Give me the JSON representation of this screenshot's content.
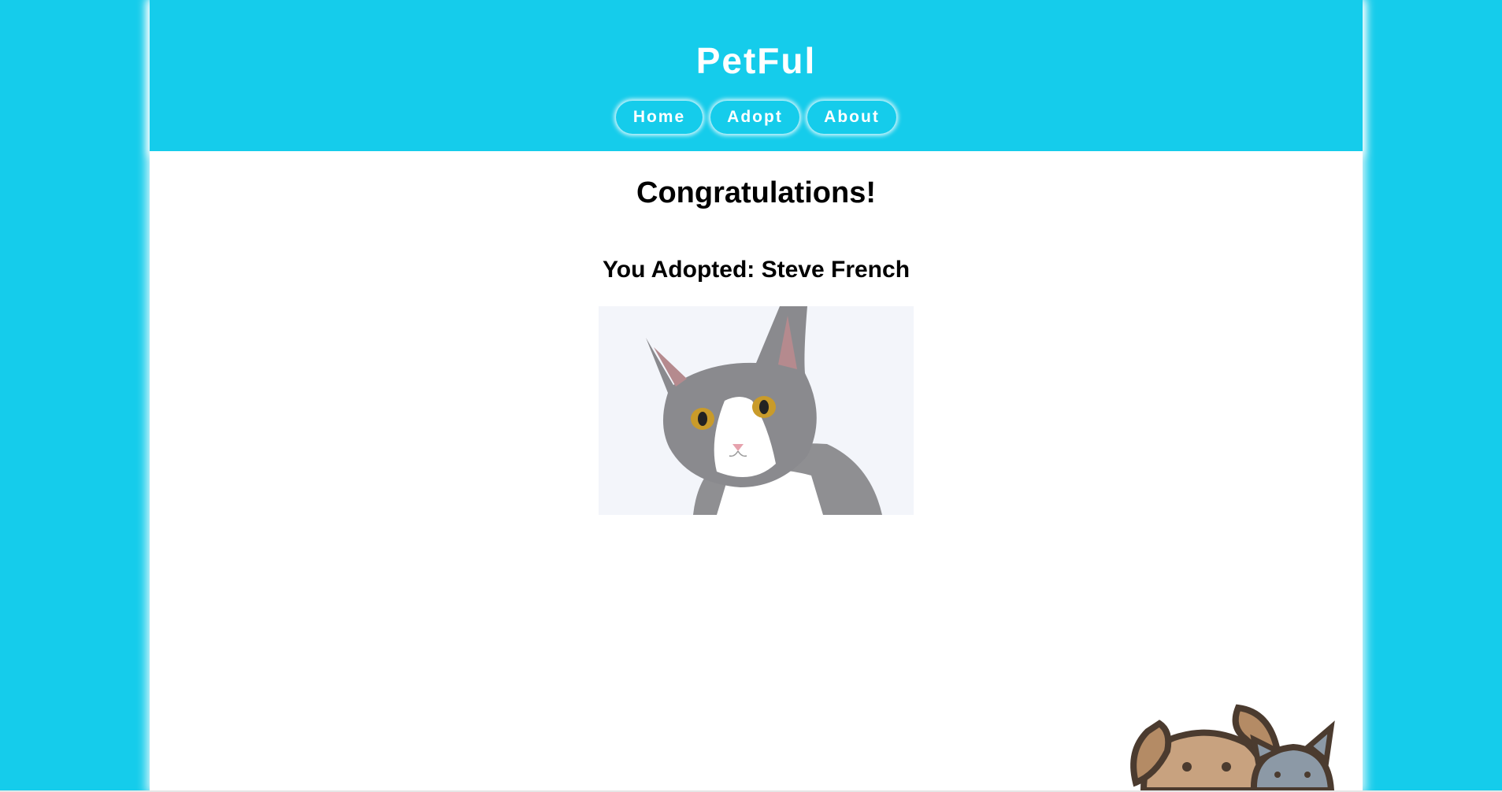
{
  "header": {
    "title": "PetFul"
  },
  "nav": {
    "home": "Home",
    "adopt": "Adopt",
    "about": "About"
  },
  "main": {
    "heading": "Congratulations!",
    "adopted_line": "You Adopted: Steve French",
    "pet_image": "cat-photo"
  },
  "colors": {
    "brand": "#15cceb",
    "content_bg": "#ffffff",
    "text": "#000000"
  },
  "decor": {
    "corner_art": "dog-and-cat-illustration"
  }
}
